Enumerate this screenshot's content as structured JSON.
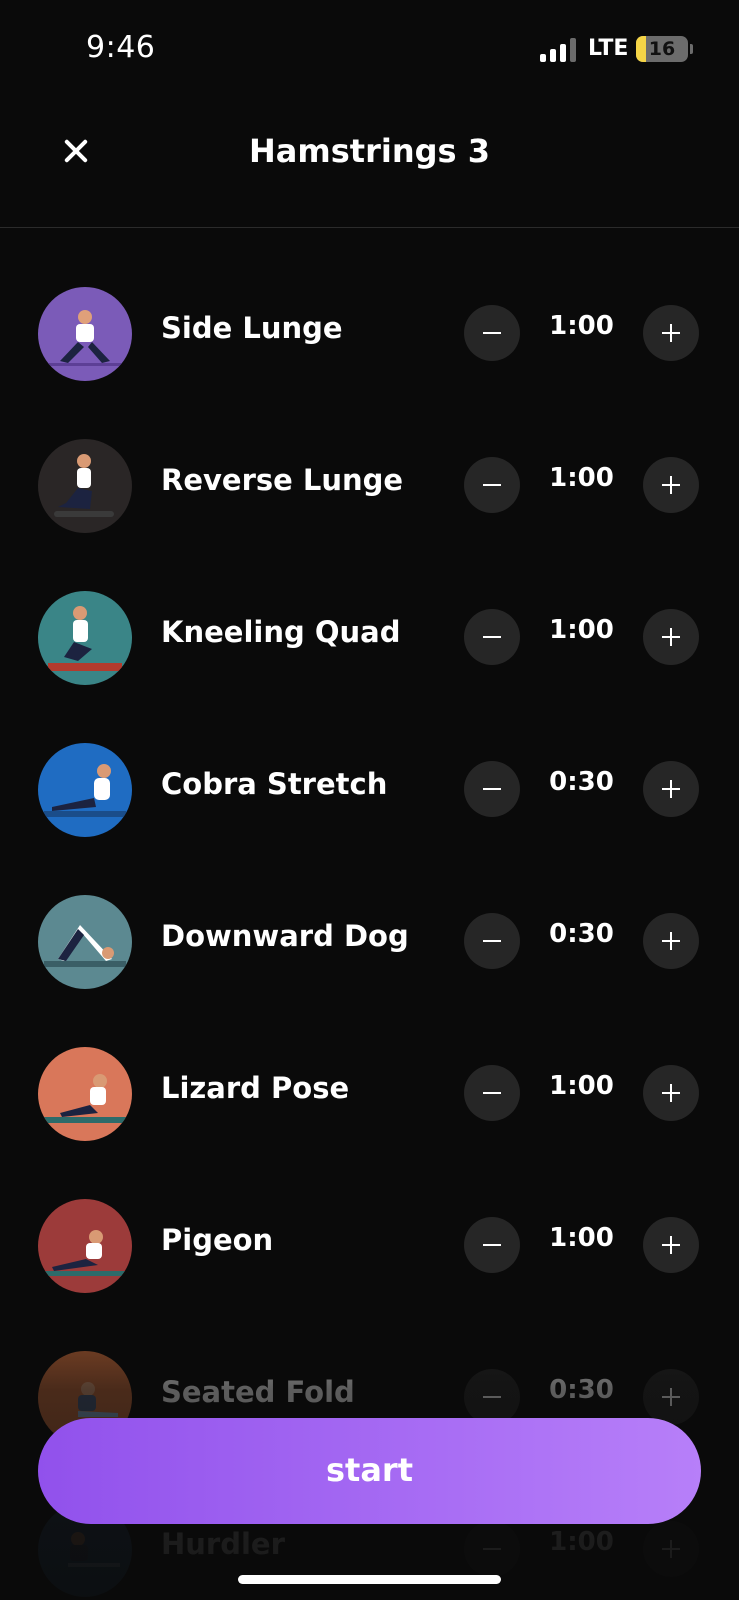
{
  "status_bar": {
    "time": "9:46",
    "network": "LTE",
    "battery": "16",
    "battery_level": 0.16,
    "signal_bars": 3,
    "battery_color": "#f5d547"
  },
  "header": {
    "title": "Hamstrings 3",
    "close_icon": "close-icon"
  },
  "exercises": [
    {
      "name": "Side Lunge",
      "duration": "1:00",
      "avatar_color": "#7b5bb8"
    },
    {
      "name": "Reverse Lunge",
      "duration": "1:00",
      "avatar_color": "#2a2626"
    },
    {
      "name": "Kneeling Quad",
      "duration": "1:00",
      "avatar_color": "#3a8587"
    },
    {
      "name": "Cobra Stretch",
      "duration": "0:30",
      "avatar_color": "#1f6cc2"
    },
    {
      "name": "Downward Dog",
      "duration": "0:30",
      "avatar_color": "#5c8991"
    },
    {
      "name": "Lizard Pose",
      "duration": "1:00",
      "avatar_color": "#d9775a"
    },
    {
      "name": "Pigeon",
      "duration": "1:00",
      "avatar_color": "#9c3b3a"
    },
    {
      "name": "Seated Fold",
      "duration": "0:30",
      "avatar_color": "#c76b3a"
    },
    {
      "name": "Hurdler",
      "duration": "1:00",
      "avatar_color": "#2f5d8a"
    }
  ],
  "controls": {
    "decrease_icon": "minus-icon",
    "increase_icon": "plus-icon"
  },
  "start_button": {
    "label": "start",
    "gradient_start": "#9151ec",
    "gradient_end": "#b77ff9"
  }
}
